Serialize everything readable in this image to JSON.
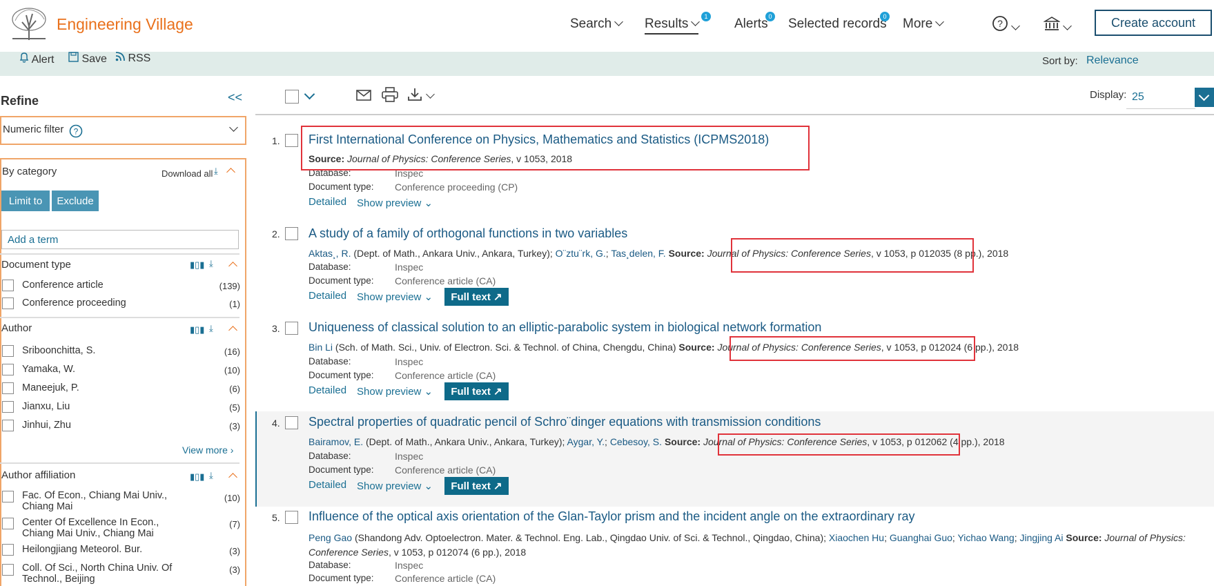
{
  "header": {
    "brand": "Engineering Village",
    "nav": [
      {
        "label": "Search"
      },
      {
        "label": "Results",
        "badge": "1"
      },
      {
        "label": "Alerts",
        "badge": "0"
      },
      {
        "label": "Selected records",
        "badge": "0"
      },
      {
        "label": "More"
      }
    ],
    "create_account": "Create account"
  },
  "toolbar": {
    "alert": "Alert",
    "save": "Save",
    "rss": "RSS",
    "sort_label": "Sort by:",
    "sort_value": "Relevance",
    "display_label": "Display:",
    "display_value": "25"
  },
  "sidebar": {
    "refine": "Refine",
    "collapse": "<<",
    "numeric_filter": "Numeric filter",
    "by_category": "By category",
    "download_all": "Download all",
    "limit_to": "Limit to",
    "exclude": "Exclude",
    "add_term": "Add a term",
    "sections": [
      {
        "title": "Document type",
        "items": [
          {
            "label": "Conference article",
            "count": "(139)"
          },
          {
            "label": "Conference proceeding",
            "count": "(1)"
          }
        ]
      },
      {
        "title": "Author",
        "items": [
          {
            "label": "Sriboonchitta, S.",
            "count": "(16)"
          },
          {
            "label": "Yamaka, W.",
            "count": "(10)"
          },
          {
            "label": "Maneejuk, P.",
            "count": "(6)"
          },
          {
            "label": "Jianxu, Liu",
            "count": "(5)"
          },
          {
            "label": "Jinhui, Zhu",
            "count": "(3)"
          }
        ],
        "view_more": "View more"
      },
      {
        "title": "Author affiliation",
        "items": [
          {
            "label": "Fac. Of Econ., Chiang Mai Univ., Chiang Mai",
            "count": "(10)"
          },
          {
            "label": "Center Of Excellence In Econ., Chiang Mai Univ., Chiang Mai",
            "count": "(7)"
          },
          {
            "label": "Heilongjiang Meteorol. Bur.",
            "count": "(3)"
          },
          {
            "label": "Coll. Of Sci., North China Univ. Of Technol., Beijing",
            "count": "(3)"
          }
        ]
      }
    ]
  },
  "results": {
    "labels": {
      "source": "Source:",
      "database": "Database:",
      "doctype": "Document type:",
      "detailed": "Detailed",
      "show_preview": "Show preview",
      "full_text": "Full text"
    },
    "items": [
      {
        "num": "1.",
        "title": "First International Conference on Physics, Mathematics and Statistics (ICPMS2018)",
        "journal": "Journal of Physics: Conference Series",
        "rest": ", v 1053, 2018",
        "database": "Inspec",
        "doctype": "Conference proceeding (CP)"
      },
      {
        "num": "2.",
        "title": "A study of a family of orthogonal functions in two variables",
        "authors": [
          {
            "name": "Aktas¸, R.",
            "aff": " (Dept. of Math., Ankara Univ., Ankara, Turkey); "
          },
          {
            "name": "O¨ztu¨rk, G.",
            "aff": "; "
          },
          {
            "name": "Tas¸delen, F.",
            "aff": " "
          }
        ],
        "journal": "Journal of Physics: Conference Series",
        "rest": ", v 1053, p 012035 (8 pp.), 2018",
        "database": "Inspec",
        "doctype": "Conference article (CA)"
      },
      {
        "num": "3.",
        "title": "Uniqueness of classical solution to an elliptic-parabolic system in biological network formation",
        "authors": [
          {
            "name": "Bin Li",
            "aff": " (Sch. of Math. Sci., Univ. of Electron. Sci. & Technol. of China, Chengdu, China) "
          }
        ],
        "journal": "Journal of Physics: Conference Series",
        "rest": ", v 1053, p 012024 (6 pp.), 2018",
        "database": "Inspec",
        "doctype": "Conference article (CA)"
      },
      {
        "num": "4.",
        "title": "Spectral properties of quadratic pencil of Schro¨dinger equations with transmission conditions",
        "authors": [
          {
            "name": "Bairamov, E.",
            "aff": " (Dept. of Math., Ankara Univ., Ankara, Turkey); "
          },
          {
            "name": "Aygar, Y.",
            "aff": "; "
          },
          {
            "name": "Cebesoy, S.",
            "aff": " "
          }
        ],
        "journal": "Journal of Physics: Conference Series",
        "rest": ", v 1053, p 012062 (4 pp.), 2018",
        "database": "Inspec",
        "doctype": "Conference article (CA)"
      },
      {
        "num": "5.",
        "title": "Influence of the optical axis orientation of the Glan-Taylor prism and the incident angle on the extraordinary ray",
        "authors": [
          {
            "name": "Peng Gao",
            "aff": " (Shandong Adv. Optoelectron. Mater. & Technol. Eng. Lab., Qingdao Univ. of Sci. & Technol., Qingdao, China); "
          },
          {
            "name": "Xiaochen Hu",
            "aff": "; "
          },
          {
            "name": "Guanghai Guo",
            "aff": "; "
          },
          {
            "name": "Yichao Wang",
            "aff": "; "
          },
          {
            "name": "Jingjing Ai",
            "aff": " "
          }
        ],
        "journal": "Journal of Physics: Conference Series",
        "rest": ", v 1053, p 012074 (6 pp.), 2018",
        "database": "Inspec",
        "doctype": "Conference article (CA)"
      }
    ]
  }
}
